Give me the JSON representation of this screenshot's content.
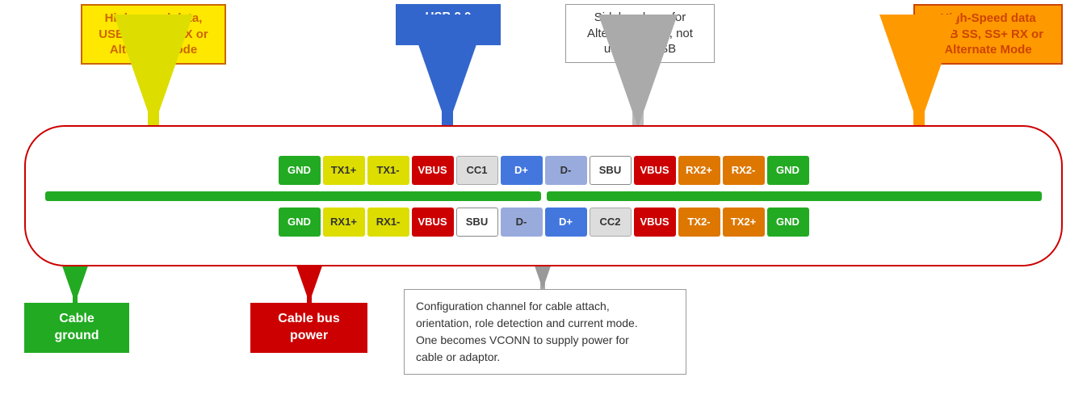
{
  "annotations": {
    "top_left_yellow": {
      "text": "High-speed data,\nUSB SS, SS+ TX or\nAlternate Mode",
      "bg": "#FFE800",
      "text_color": "#CC6600"
    },
    "top_center_blue": {
      "text": "USB 2.0\nData",
      "bg": "#3366CC",
      "text_color": "white"
    },
    "top_center_white": {
      "text": "Sideband use for\nAlternate Mode, not\nused for USB",
      "bg": "white",
      "text_color": "#333333"
    },
    "top_right_orange": {
      "text": "High-Speed data\nUSB SS, SS+ RX or\nAlternate Mode",
      "bg": "#FF9900",
      "text_color": "#CC4400"
    },
    "bottom_green": {
      "text": "Cable\nground",
      "bg": "#22AA22",
      "text_color": "white"
    },
    "bottom_red": {
      "text": "Cable bus\npower",
      "bg": "#CC0000",
      "text_color": "white"
    },
    "bottom_white": {
      "text": "Configuration channel for cable attach,\norientation, role detection and current mode.\nOne becomes VCONN to supply power for\ncable or adaptor.",
      "bg": "white",
      "text_color": "#333333"
    }
  },
  "top_row": [
    {
      "label": "GND",
      "class": "pin-green"
    },
    {
      "label": "TX1+",
      "class": "pin-yellow"
    },
    {
      "label": "TX1-",
      "class": "pin-yellow"
    },
    {
      "label": "VBUS",
      "class": "pin-red"
    },
    {
      "label": "CC1",
      "class": "pin-white"
    },
    {
      "label": "D+",
      "class": "pin-blue"
    },
    {
      "label": "D-",
      "class": "pin-lightblue"
    },
    {
      "label": "SBU",
      "class": "pin-bold"
    },
    {
      "label": "VBUS",
      "class": "pin-red"
    },
    {
      "label": "RX2+",
      "class": "pin-orange"
    },
    {
      "label": "RX2-",
      "class": "pin-orange"
    },
    {
      "label": "GND",
      "class": "pin-green"
    }
  ],
  "bottom_row": [
    {
      "label": "GND",
      "class": "pin-green"
    },
    {
      "label": "RX1+",
      "class": "pin-yellow"
    },
    {
      "label": "RX1-",
      "class": "pin-yellow"
    },
    {
      "label": "VBUS",
      "class": "pin-red"
    },
    {
      "label": "SBU",
      "class": "pin-bold"
    },
    {
      "label": "D-",
      "class": "pin-lightblue"
    },
    {
      "label": "D+",
      "class": "pin-blue"
    },
    {
      "label": "CC2",
      "class": "pin-white"
    },
    {
      "label": "VBUS",
      "class": "pin-red"
    },
    {
      "label": "TX2-",
      "class": "pin-orange"
    },
    {
      "label": "TX2+",
      "class": "pin-orange"
    },
    {
      "label": "GND",
      "class": "pin-green"
    }
  ]
}
